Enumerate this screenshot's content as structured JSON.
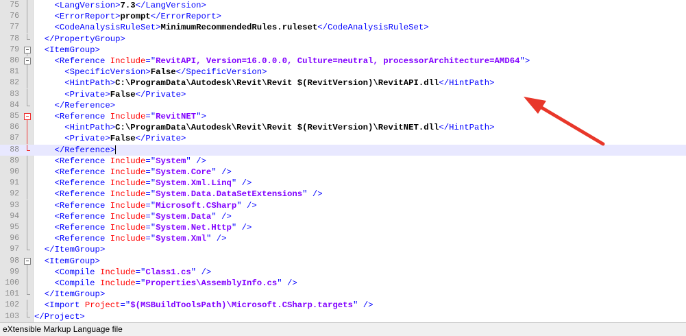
{
  "editor": {
    "lines": [
      {
        "num": "75",
        "fold": "line",
        "parts": [
          [
            "tag",
            "<LangVersion>"
          ],
          [
            "txt",
            "7.3"
          ],
          [
            "tag",
            "</LangVersion>"
          ]
        ],
        "indent": "    "
      },
      {
        "num": "76",
        "fold": "line",
        "parts": [
          [
            "tag",
            "<ErrorReport>"
          ],
          [
            "txt",
            "prompt"
          ],
          [
            "tag",
            "</ErrorReport>"
          ]
        ],
        "indent": "    "
      },
      {
        "num": "77",
        "fold": "line",
        "parts": [
          [
            "tag",
            "<CodeAnalysisRuleSet>"
          ],
          [
            "txt",
            "MinimumRecommendedRules.ruleset"
          ],
          [
            "tag",
            "</CodeAnalysisRuleSet>"
          ]
        ],
        "indent": "    "
      },
      {
        "num": "78",
        "fold": "end",
        "parts": [
          [
            "tag",
            "</PropertyGroup>"
          ]
        ],
        "indent": "  "
      },
      {
        "num": "79",
        "fold": "box",
        "parts": [
          [
            "tag",
            "<ItemGroup>"
          ]
        ],
        "indent": "  "
      },
      {
        "num": "80",
        "fold": "box",
        "parts": [
          [
            "tag",
            "<Reference "
          ],
          [
            "attr",
            "Include"
          ],
          [
            "tag",
            "=\""
          ],
          [
            "str",
            "RevitAPI, Version=16.0.0.0, Culture=neutral, processorArchitecture=AMD64"
          ],
          [
            "tag",
            "\">"
          ]
        ],
        "indent": "    "
      },
      {
        "num": "81",
        "fold": "line",
        "parts": [
          [
            "tag",
            "<SpecificVersion>"
          ],
          [
            "txt",
            "False"
          ],
          [
            "tag",
            "</SpecificVersion>"
          ]
        ],
        "indent": "      "
      },
      {
        "num": "82",
        "fold": "line",
        "parts": [
          [
            "tag",
            "<HintPath>"
          ],
          [
            "txt",
            "C:\\ProgramData\\Autodesk\\Revit\\Revit $(RevitVersion)\\RevitAPI.dll"
          ],
          [
            "tag",
            "</HintPath>"
          ]
        ],
        "indent": "      "
      },
      {
        "num": "83",
        "fold": "line",
        "parts": [
          [
            "tag",
            "<Private>"
          ],
          [
            "txt",
            "False"
          ],
          [
            "tag",
            "</Private>"
          ]
        ],
        "indent": "      "
      },
      {
        "num": "84",
        "fold": "end",
        "parts": [
          [
            "tag",
            "</Reference>"
          ]
        ],
        "indent": "    "
      },
      {
        "num": "85",
        "fold": "boxred",
        "parts": [
          [
            "tag",
            "<Reference "
          ],
          [
            "attr",
            "Include"
          ],
          [
            "tag",
            "=\""
          ],
          [
            "str",
            "RevitNET"
          ],
          [
            "tag",
            "\">"
          ]
        ],
        "indent": "    "
      },
      {
        "num": "86",
        "fold": "linered",
        "parts": [
          [
            "tag",
            "<HintPath>"
          ],
          [
            "txt",
            "C:\\ProgramData\\Autodesk\\Revit\\Revit $(RevitVersion)\\RevitNET.dll"
          ],
          [
            "tag",
            "</HintPath>"
          ]
        ],
        "indent": "      "
      },
      {
        "num": "87",
        "fold": "linered",
        "parts": [
          [
            "tag",
            "<Private>"
          ],
          [
            "txt",
            "False"
          ],
          [
            "tag",
            "</Private>"
          ]
        ],
        "indent": "      "
      },
      {
        "num": "88",
        "fold": "endred",
        "parts": [
          [
            "tag",
            "</Reference>"
          ]
        ],
        "indent": "    ",
        "current": true
      },
      {
        "num": "89",
        "fold": "line",
        "parts": [
          [
            "tag",
            "<Reference "
          ],
          [
            "attr",
            "Include"
          ],
          [
            "tag",
            "=\""
          ],
          [
            "str",
            "System"
          ],
          [
            "tag",
            "\" />"
          ]
        ],
        "indent": "    "
      },
      {
        "num": "90",
        "fold": "line",
        "parts": [
          [
            "tag",
            "<Reference "
          ],
          [
            "attr",
            "Include"
          ],
          [
            "tag",
            "=\""
          ],
          [
            "str",
            "System.Core"
          ],
          [
            "tag",
            "\" />"
          ]
        ],
        "indent": "    "
      },
      {
        "num": "91",
        "fold": "line",
        "parts": [
          [
            "tag",
            "<Reference "
          ],
          [
            "attr",
            "Include"
          ],
          [
            "tag",
            "=\""
          ],
          [
            "str",
            "System.Xml.Linq"
          ],
          [
            "tag",
            "\" />"
          ]
        ],
        "indent": "    "
      },
      {
        "num": "92",
        "fold": "line",
        "parts": [
          [
            "tag",
            "<Reference "
          ],
          [
            "attr",
            "Include"
          ],
          [
            "tag",
            "=\""
          ],
          [
            "str",
            "System.Data.DataSetExtensions"
          ],
          [
            "tag",
            "\" />"
          ]
        ],
        "indent": "    "
      },
      {
        "num": "93",
        "fold": "line",
        "parts": [
          [
            "tag",
            "<Reference "
          ],
          [
            "attr",
            "Include"
          ],
          [
            "tag",
            "=\""
          ],
          [
            "str",
            "Microsoft.CSharp"
          ],
          [
            "tag",
            "\" />"
          ]
        ],
        "indent": "    "
      },
      {
        "num": "94",
        "fold": "line",
        "parts": [
          [
            "tag",
            "<Reference "
          ],
          [
            "attr",
            "Include"
          ],
          [
            "tag",
            "=\""
          ],
          [
            "str",
            "System.Data"
          ],
          [
            "tag",
            "\" />"
          ]
        ],
        "indent": "    "
      },
      {
        "num": "95",
        "fold": "line",
        "parts": [
          [
            "tag",
            "<Reference "
          ],
          [
            "attr",
            "Include"
          ],
          [
            "tag",
            "=\""
          ],
          [
            "str",
            "System.Net.Http"
          ],
          [
            "tag",
            "\" />"
          ]
        ],
        "indent": "    "
      },
      {
        "num": "96",
        "fold": "line",
        "parts": [
          [
            "tag",
            "<Reference "
          ],
          [
            "attr",
            "Include"
          ],
          [
            "tag",
            "=\""
          ],
          [
            "str",
            "System.Xml"
          ],
          [
            "tag",
            "\" />"
          ]
        ],
        "indent": "    "
      },
      {
        "num": "97",
        "fold": "end",
        "parts": [
          [
            "tag",
            "</ItemGroup>"
          ]
        ],
        "indent": "  "
      },
      {
        "num": "98",
        "fold": "box",
        "parts": [
          [
            "tag",
            "<ItemGroup>"
          ]
        ],
        "indent": "  "
      },
      {
        "num": "99",
        "fold": "line",
        "parts": [
          [
            "tag",
            "<Compile "
          ],
          [
            "attr",
            "Include"
          ],
          [
            "tag",
            "=\""
          ],
          [
            "str",
            "Class1.cs"
          ],
          [
            "tag",
            "\" />"
          ]
        ],
        "indent": "    "
      },
      {
        "num": "100",
        "fold": "line",
        "parts": [
          [
            "tag",
            "<Compile "
          ],
          [
            "attr",
            "Include"
          ],
          [
            "tag",
            "=\""
          ],
          [
            "str",
            "Properties\\AssemblyInfo.cs"
          ],
          [
            "tag",
            "\" />"
          ]
        ],
        "indent": "    "
      },
      {
        "num": "101",
        "fold": "end",
        "parts": [
          [
            "tag",
            "</ItemGroup>"
          ]
        ],
        "indent": "  "
      },
      {
        "num": "102",
        "fold": "line",
        "parts": [
          [
            "tag",
            "<Import "
          ],
          [
            "attr",
            "Project"
          ],
          [
            "tag",
            "=\""
          ],
          [
            "str",
            "$(MSBuildToolsPath)\\Microsoft.CSharp.targets"
          ],
          [
            "tag",
            "\" />"
          ]
        ],
        "indent": "  "
      },
      {
        "num": "103",
        "fold": "end",
        "parts": [
          [
            "tag",
            "</Project>"
          ]
        ],
        "indent": ""
      }
    ]
  },
  "statusbar": {
    "file_type": "eXtensible Markup Language file"
  },
  "colors": {
    "tag": "#0000ff",
    "attribute": "#ff0000",
    "string": "#8000ff",
    "text": "#000000",
    "arrow": "#e8372a",
    "current_line": "#e8e8ff"
  }
}
